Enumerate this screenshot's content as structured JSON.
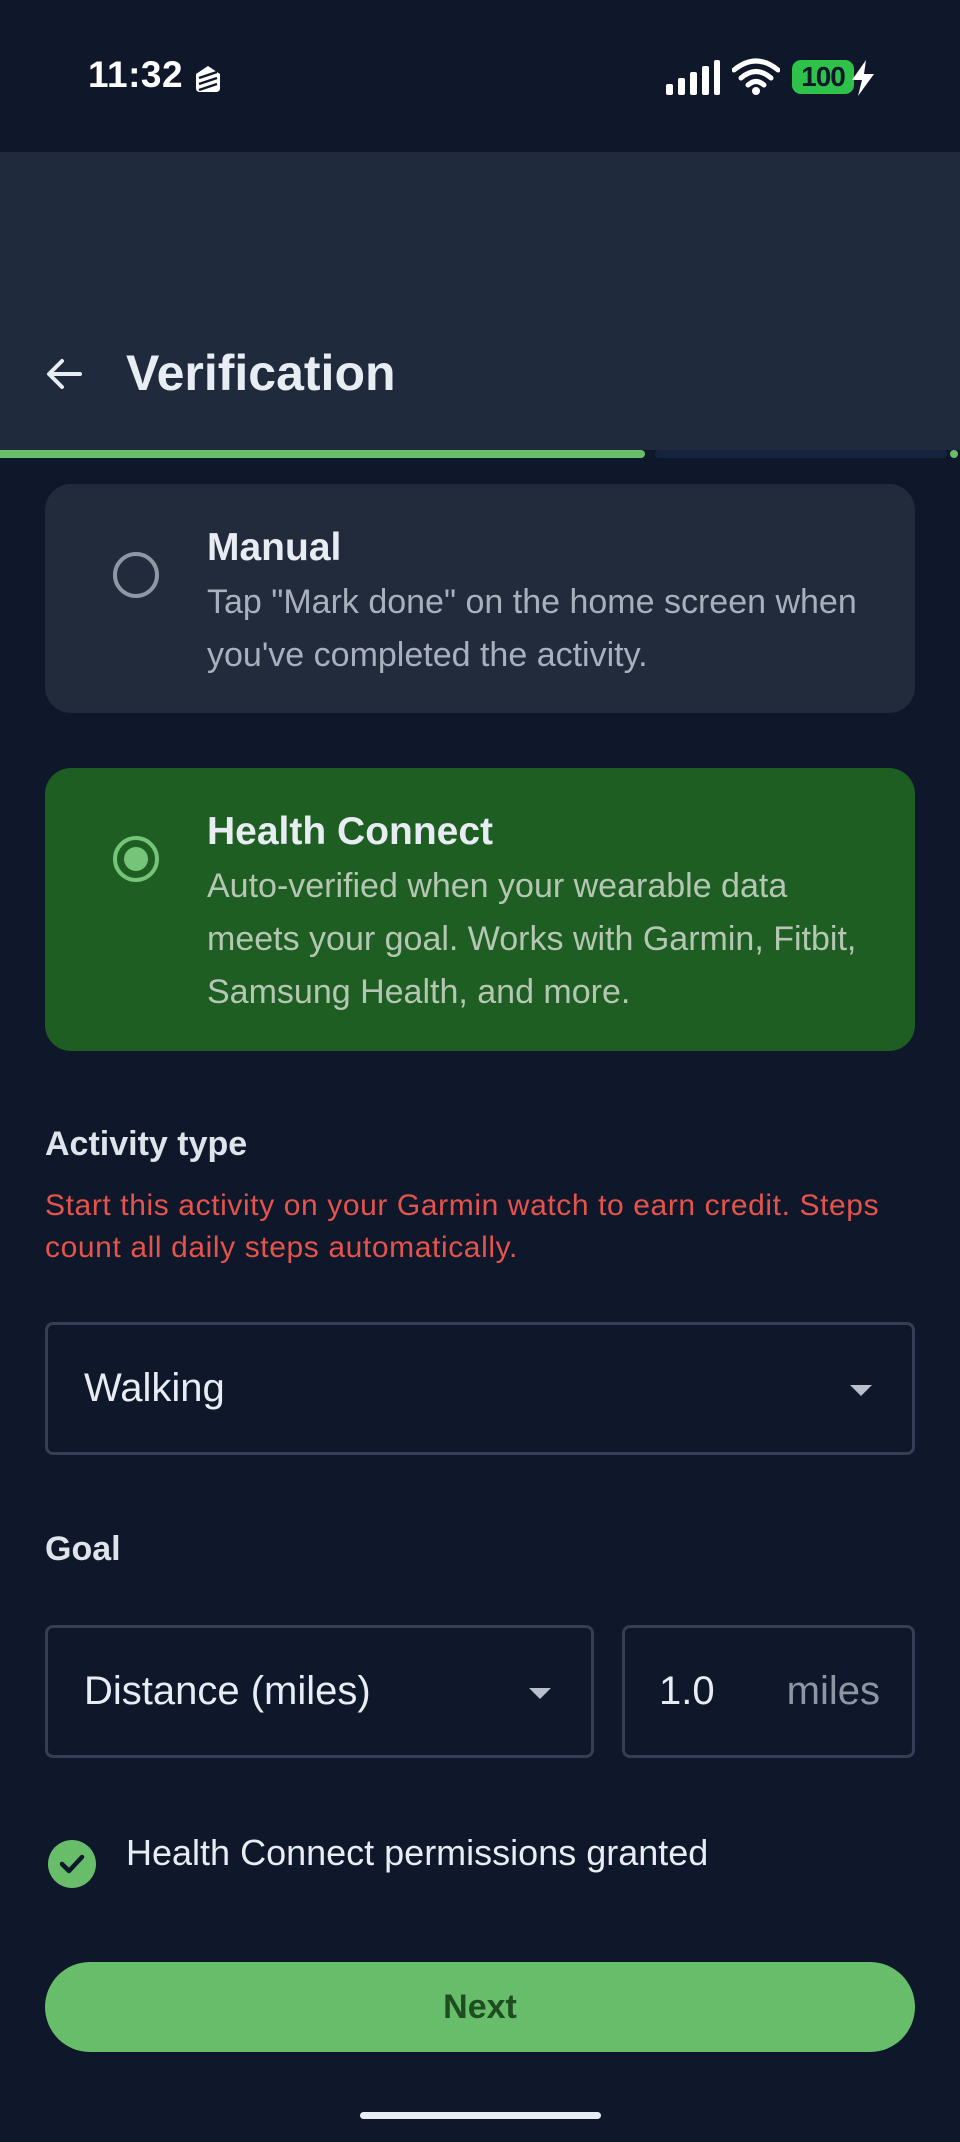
{
  "status_bar": {
    "time": "11:32",
    "battery": "100",
    "icons": [
      "app-notification-icon",
      "signal-icon",
      "wifi-icon",
      "battery-icon",
      "charging-bolt-icon"
    ]
  },
  "app_bar": {
    "title": "Verification",
    "back_icon": "arrow-back-icon",
    "progress": 0.67
  },
  "options": [
    {
      "title": "Manual",
      "description": "Tap \"Mark done\" on the home screen when you've completed the activity.",
      "selected": false
    },
    {
      "title": "Health Connect",
      "description": "Auto-verified when your wearable data meets your goal. Works with Garmin, Fitbit, Samsung Health, and more.",
      "selected": true
    }
  ],
  "activity": {
    "label": "Activity type",
    "warning": "Start this activity on your Garmin watch to earn credit. Steps count all daily steps automatically.",
    "selected": "Walking"
  },
  "goal": {
    "label": "Goal",
    "metric": "Distance (miles)",
    "value": "1.0",
    "unit": "miles"
  },
  "permission": {
    "text": "Health Connect permissions granted"
  },
  "next_button": {
    "label": "Next"
  },
  "colors": {
    "background": "#0f182b",
    "app_bar": "#1f2a3c",
    "accent_green": "#67bd69",
    "selected_card": "#1e5e22",
    "warning_red": "#e5534b"
  }
}
